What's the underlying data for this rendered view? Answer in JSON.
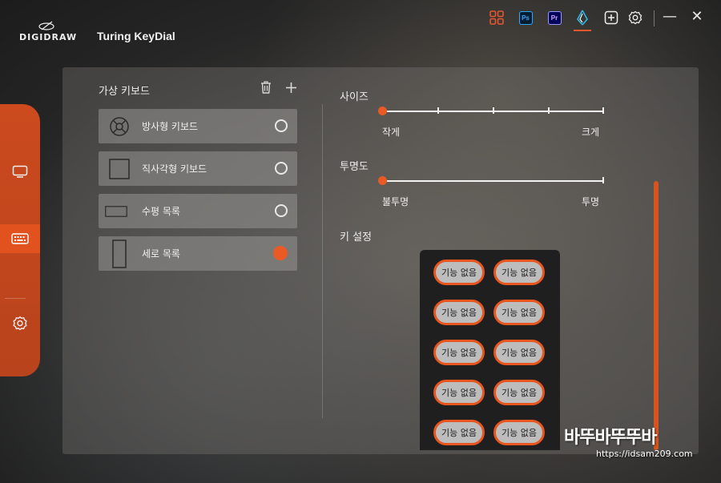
{
  "app": {
    "brand": "DIGIDRAW",
    "title": "Turing KeyDial"
  },
  "toolbar": {
    "icons": [
      "grid-icon",
      "photoshop-icon",
      "premiere-icon",
      "keydial-icon",
      "add-icon",
      "settings-icon"
    ],
    "ps_label": "Ps",
    "pr_label": "Pr",
    "minimize": "—",
    "close": "✕"
  },
  "rail": {
    "items": [
      "monitor-icon",
      "keyboard-icon",
      "settings-icon"
    ],
    "active_index": 1
  },
  "virtual_keyboard": {
    "title": "가상 키보드",
    "items": [
      {
        "label": "방사형 키보드",
        "icon": "radial-icon",
        "selected": false
      },
      {
        "label": "직사각형 키보드",
        "icon": "rectangle-icon",
        "selected": false
      },
      {
        "label": "수평 목록",
        "icon": "horizontal-list-icon",
        "selected": false
      },
      {
        "label": "세로 목록",
        "icon": "vertical-list-icon",
        "selected": true
      }
    ]
  },
  "size": {
    "title": "사이즈",
    "min_label": "작게",
    "max_label": "크게",
    "value_fraction": 0
  },
  "opacity": {
    "title": "투명도",
    "min_label": "불투명",
    "max_label": "투명",
    "value_fraction": 0
  },
  "key_settings": {
    "title": "키 설정",
    "keys": [
      "기능 없음",
      "기능 없음",
      "기능 없음",
      "기능 없음",
      "기능 없음",
      "기능 없음",
      "기능 없음",
      "기능 없음",
      "기능 없음",
      "기능 없음"
    ]
  },
  "colors": {
    "accent": "#e4572e"
  },
  "watermark": {
    "main": "바뚜바뚜뚜바",
    "url": "https://idsam209.com"
  }
}
